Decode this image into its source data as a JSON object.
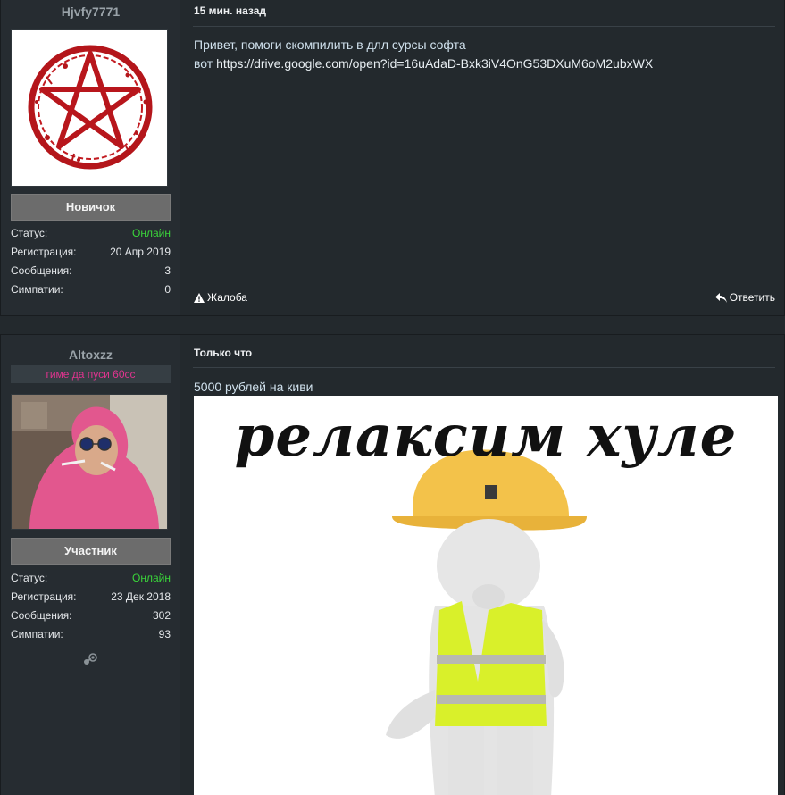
{
  "posts": [
    {
      "username": "Hjvfy7771",
      "rank": "Новичок",
      "time": "15 мин. назад",
      "stats": [
        {
          "label": "Статус:",
          "value": "Онлайн"
        },
        {
          "label": "Регистрация:",
          "value": "20 Апр 2019"
        },
        {
          "label": "Сообщения:",
          "value": "3"
        },
        {
          "label": "Симпатии:",
          "value": "0"
        }
      ],
      "message_line1": "Привет, помоги скомпилить в длл сурсы софта",
      "message_prefix": "вот ",
      "message_link": "https://drive.google.com/open?id=16uAdaD-Bxk3iV4OnG53DXuM6oM2ubxWX",
      "complain_label": "Жалоба",
      "reply_label": "Ответить"
    },
    {
      "username": "Altoxzz",
      "user_title": "гиме да пуси 60сс",
      "rank": "Участник",
      "time": "Только что",
      "stats": [
        {
          "label": "Статус:",
          "value": "Онлайн"
        },
        {
          "label": "Регистрация:",
          "value": "23 Дек 2018"
        },
        {
          "label": "Сообщения:",
          "value": "302"
        },
        {
          "label": "Симпатии:",
          "value": "93"
        }
      ],
      "message_line1": "5000 рублей на киви",
      "image_caption": "релаксим хуле"
    }
  ],
  "colors": {
    "background": "#23292d",
    "online": "#3ad63a",
    "user_title": "#e0348f",
    "rank_button": "#6c6c6c"
  }
}
